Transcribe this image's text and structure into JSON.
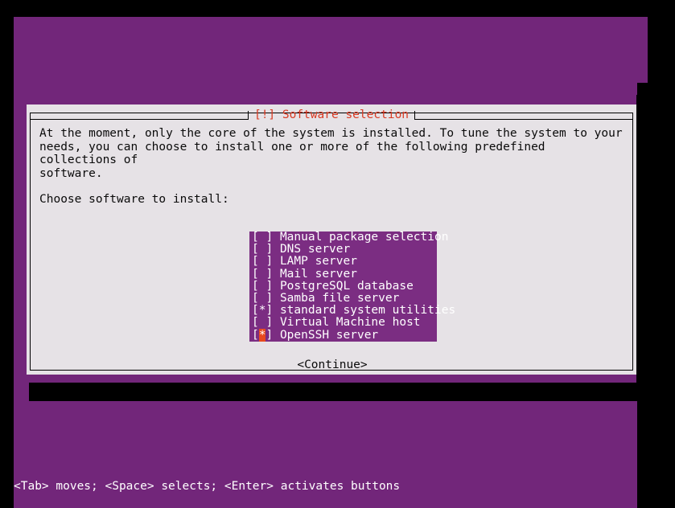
{
  "desktop": {
    "background_color": "#72267a",
    "frame_color": "#000000"
  },
  "dialog": {
    "title": "[!] Software selection",
    "title_color": "#d93a23",
    "background_color": "#e6e2e6",
    "text_color": "#0a0a0a",
    "paragraph": "At the moment, only the core of the system is installed. To tune the system to your\nneeds, you can choose to install one or more of the following predefined collections of\nsoftware.",
    "prompt": "Choose software to install:",
    "continue_label": "<Continue>"
  },
  "selection_list": {
    "background_color": "#7b2d82",
    "text_color": "#ffffff",
    "cursor_color": "#e8491d",
    "checked_mark": "*",
    "unchecked_mark": " ",
    "bracket_open": "[",
    "bracket_close": "]",
    "items": [
      {
        "label": "Manual package selection",
        "checked": false,
        "cursor": false
      },
      {
        "label": "DNS server",
        "checked": false,
        "cursor": false
      },
      {
        "label": "LAMP server",
        "checked": false,
        "cursor": false
      },
      {
        "label": "Mail server",
        "checked": false,
        "cursor": false
      },
      {
        "label": "PostgreSQL database",
        "checked": false,
        "cursor": false
      },
      {
        "label": "Samba file server",
        "checked": false,
        "cursor": false
      },
      {
        "label": "standard system utilities",
        "checked": true,
        "cursor": false
      },
      {
        "label": "Virtual Machine host",
        "checked": false,
        "cursor": false
      },
      {
        "label": "OpenSSH server",
        "checked": true,
        "cursor": true
      }
    ]
  },
  "help_bar": {
    "text": "<Tab> moves; <Space> selects; <Enter> activates buttons",
    "text_color": "#ffffff"
  }
}
